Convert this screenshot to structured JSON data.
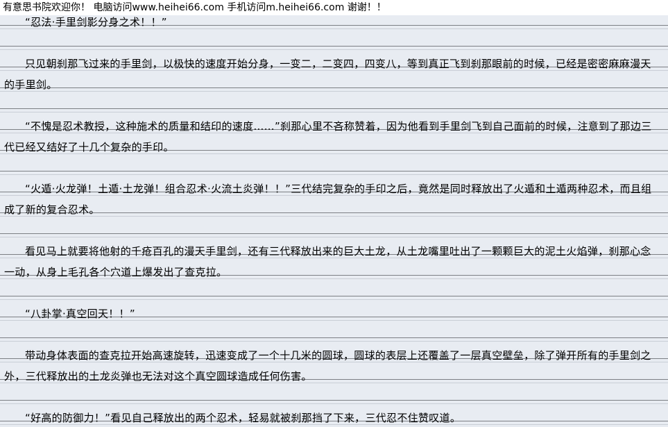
{
  "header": {
    "site_notice": "有意思书院欢迎你！  电脑访问www.heihei66.com    手机访问m.heihei66.com  谢谢！！"
  },
  "paragraphs": [
    "“忍法·手里剑影分身之术！！”",
    "只见朝刹那飞过来的手里剑，以极快的速度开始分身，一变二，二变四，四变八，等到真正飞到刹那眼前的时候，已经是密密麻麻漫天的手里剑。",
    "“不愧是忍术教授，这种施术的质量和结印的速度……”刹那心里不吝称赞着，因为他看到手里剑飞到自己面前的时候，注意到了那边三代已经又结好了十几个复杂的手印。",
    "“火遁·火龙弹！土遁·土龙弹！组合忍术·火流土炎弹！！”三代结完复杂的手印之后，竟然是同时释放出了火遁和土遁两种忍术，而且组成了新的复合忍术。",
    "看见马上就要将他射的千疮百孔的漫天手里剑，还有三代释放出来的巨大土龙，从土龙嘴里吐出了一颗颗巨大的泥土火焰弹，刹那心念一动，从身上毛孔各个穴道上爆发出了查克拉。",
    "“八卦掌·真空回天！！”",
    "带动身体表面的查克拉开始高速旋转，迅速变成了一个十几米的圆球，圆球的表层上还覆盖了一层真空壁垒，除了弹开所有的手里剑之外，三代释放出的土龙炎弹也无法对这个真空圆球造成任何伤害。",
    "“好高的防御力！”看见自己释放出的两个忍术，轻易就被刹那挡了下来，三代忍不住赞叹道。"
  ]
}
